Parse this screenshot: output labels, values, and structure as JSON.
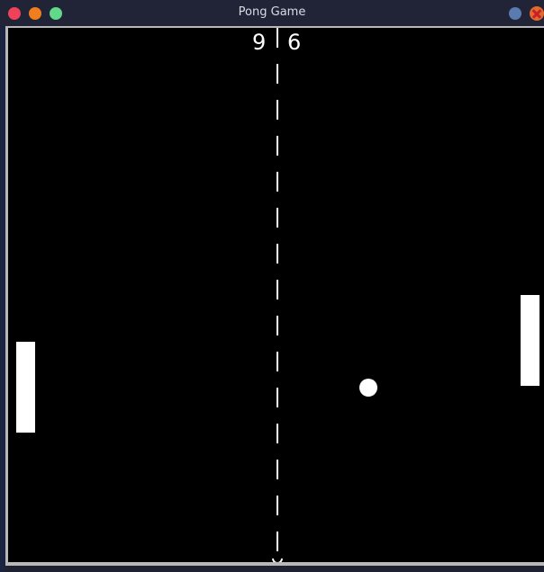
{
  "window": {
    "title": "Pong Game"
  },
  "colors": {
    "titlebar": "#202436",
    "close_red": "#f0415a",
    "minimize_orange": "#f07d1e",
    "maximize_green": "#60d98a",
    "court_background": "#000000",
    "foreground": "#ffffff"
  },
  "game": {
    "score": {
      "left": "9",
      "right": "6"
    }
  }
}
